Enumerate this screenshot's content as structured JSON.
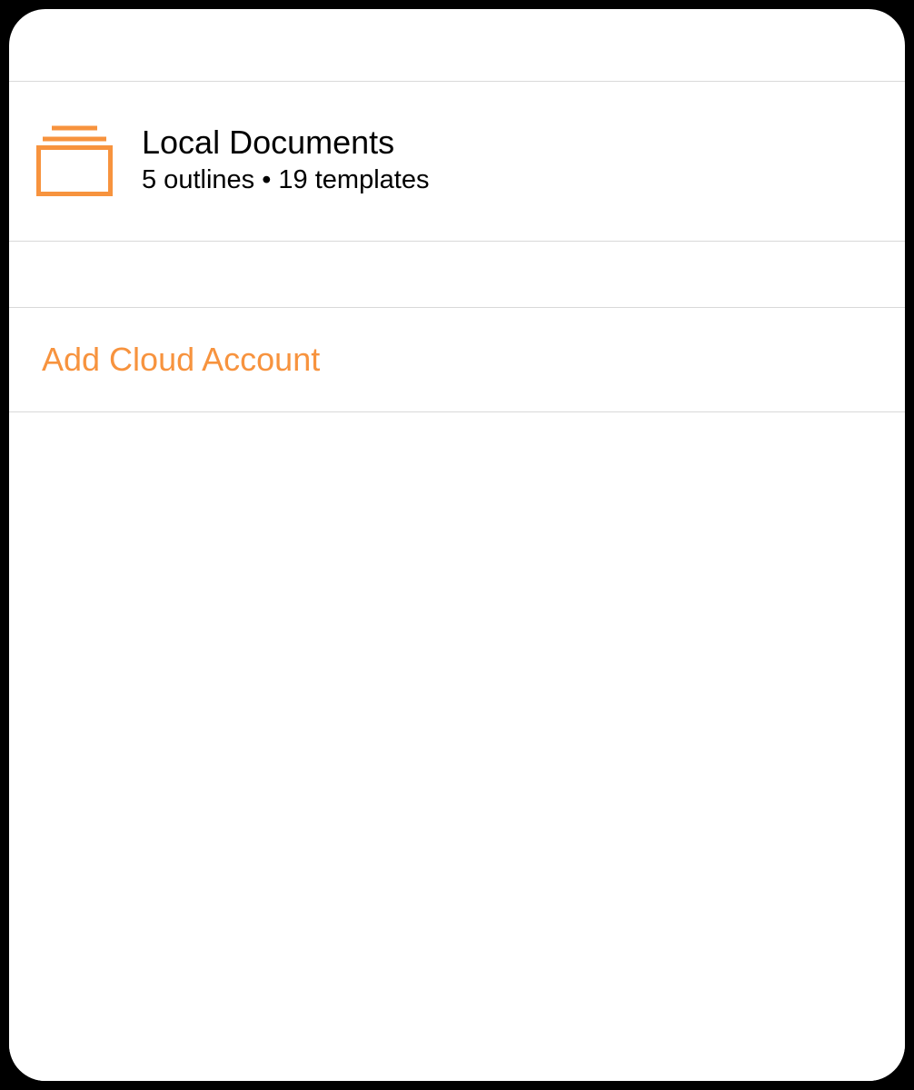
{
  "colors": {
    "accent": "#f7933e",
    "separator": "#d9d9d9"
  },
  "locations": {
    "local": {
      "title": "Local Documents",
      "subtitle": "5 outlines • 19 templates",
      "outlines_count": 5,
      "templates_count": 19
    }
  },
  "actions": {
    "add_cloud_account": "Add Cloud Account"
  }
}
